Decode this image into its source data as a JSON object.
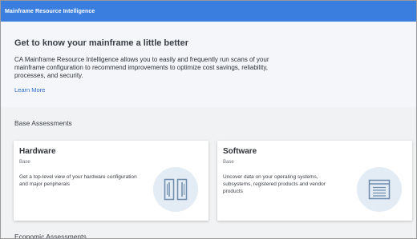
{
  "app": {
    "title": "Mainframe Resource Intelligence"
  },
  "hero": {
    "heading": "Get to know your mainframe a little better",
    "body": "CA Mainframe Resource Intelligence allows you to easily and frequently run scans of your mainframe configuration to recommend improvements to optimize cost savings, reliability, processes, and security.",
    "link": "Learn More"
  },
  "sections": {
    "base": "Base Assessments",
    "economic": "Economic Assessments"
  },
  "cards": [
    {
      "title": "Hardware",
      "subtitle": "Base",
      "description": "Get a top-level view of your hardware configuration and major peripherals",
      "icon": "hardware-icon"
    },
    {
      "title": "Software",
      "subtitle": "Base",
      "description": "Uncover data on your operating systems, subsystems, registered products and vendor products",
      "icon": "software-icon"
    }
  ],
  "colors": {
    "topbar": "#3a7ee0",
    "link": "#2f6fd0",
    "icon_stroke": "#6e8bab",
    "icon_bg": "#e3ebf4"
  }
}
